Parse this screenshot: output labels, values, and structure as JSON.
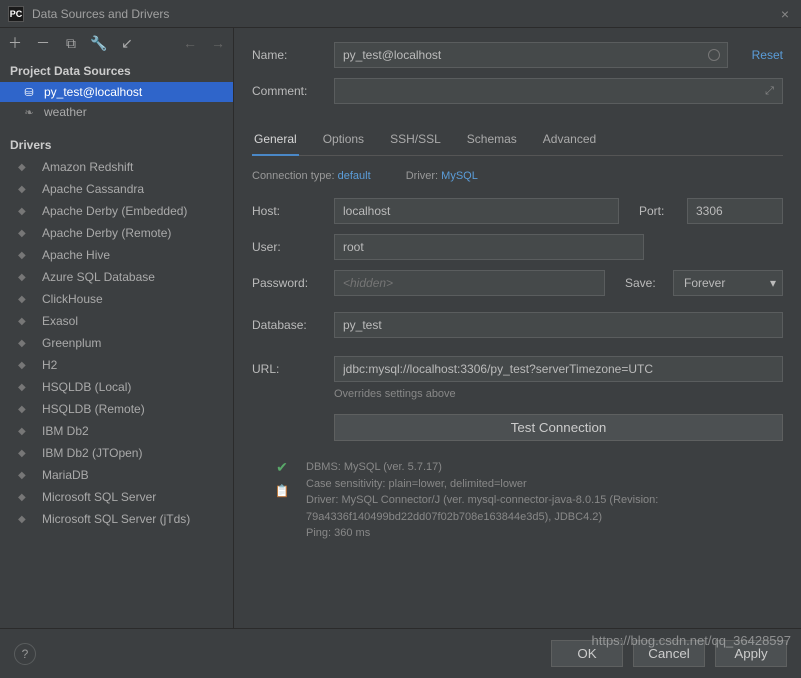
{
  "window": {
    "title": "Data Sources and Drivers",
    "app_icon_text": "PC"
  },
  "sidebar": {
    "sources_header": "Project Data Sources",
    "drivers_header": "Drivers",
    "sources": [
      {
        "label": "py_test@localhost",
        "icon": "database-icon",
        "selected": true
      },
      {
        "label": "weather",
        "icon": "leaf-icon",
        "selected": false
      }
    ],
    "drivers": [
      "Amazon Redshift",
      "Apache Cassandra",
      "Apache Derby (Embedded)",
      "Apache Derby (Remote)",
      "Apache Hive",
      "Azure SQL Database",
      "ClickHouse",
      "Exasol",
      "Greenplum",
      "H2",
      "HSQLDB (Local)",
      "HSQLDB (Remote)",
      "IBM Db2",
      "IBM Db2 (JTOpen)",
      "MariaDB",
      "Microsoft SQL Server",
      "Microsoft SQL Server (jTds)"
    ]
  },
  "form": {
    "name_label": "Name:",
    "name_value": "py_test@localhost",
    "reset_label": "Reset",
    "comment_label": "Comment:",
    "comment_value": "",
    "tabs": [
      "General",
      "Options",
      "SSH/SSL",
      "Schemas",
      "Advanced"
    ],
    "active_tab": "General",
    "connection_type_label": "Connection type:",
    "connection_type_value": "default",
    "driver_label": "Driver:",
    "driver_value": "MySQL",
    "host_label": "Host:",
    "host_value": "localhost",
    "port_label": "Port:",
    "port_value": "3306",
    "user_label": "User:",
    "user_value": "root",
    "password_label": "Password:",
    "password_placeholder": "<hidden>",
    "save_label": "Save:",
    "save_value": "Forever",
    "database_label": "Database:",
    "database_value": "py_test",
    "url_label": "URL:",
    "url_value": "jdbc:mysql://localhost:3306/py_test?serverTimezone=UTC",
    "url_hint": "Overrides settings above",
    "test_connection_label": "Test Connection"
  },
  "status": {
    "line1": "DBMS: MySQL (ver. 5.7.17)",
    "line2": "Case sensitivity: plain=lower, delimited=lower",
    "line3": "Driver: MySQL Connector/J (ver. mysql-connector-java-8.0.15 (Revision: 79a4336f140499bd22dd07f02b708e163844e3d5), JDBC4.2)",
    "line4": "Ping: 360 ms"
  },
  "footer": {
    "ok": "OK",
    "cancel": "Cancel",
    "apply": "Apply"
  },
  "watermark": "https://blog.csdn.net/qq_36428597"
}
